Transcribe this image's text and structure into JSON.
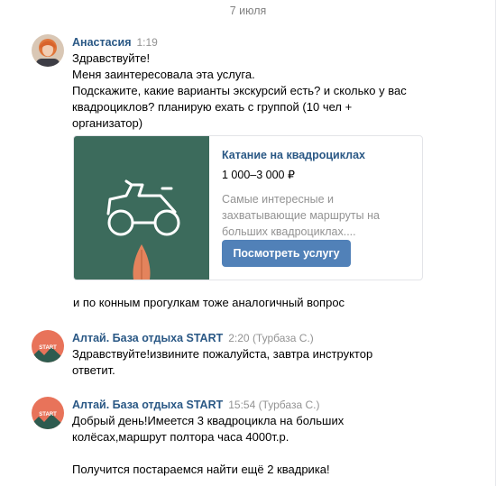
{
  "date_divider": "7 июля",
  "messages": [
    {
      "author": "Анастасия",
      "time": "1:19",
      "lines": [
        "Здравствуйте!",
        "Меня заинтересовала эта услуга.",
        "Подскажите, какие варианты экскурсий есть? и сколько у вас",
        "квадроциклов? планирую ехать с группой (10 чел +",
        "организатор)"
      ]
    },
    {
      "author": "Алтай. База отдыха START",
      "time": "2:20 (Турбаза С.)",
      "lines": [
        "Здравствуйте!извините пожалуйста, завтра инструктор",
        "ответит."
      ]
    },
    {
      "author": "Алтай. База отдыха START",
      "time": "15:54 (Турбаза С.)",
      "lines": [
        "Добрый день!Имеется 3 квадроцикла на больших",
        "колёсах,маршрут полтора часа 4000т.р.",
        "",
        "Получится постараемся найти ещё 2 квадрика!"
      ]
    }
  ],
  "service_card": {
    "title": "Катание на квадроциклах",
    "price": "1 000–3 000 ₽",
    "description": [
      "Самые интересные и",
      "захватывающие маршруты на",
      "больших квадроциклах...."
    ],
    "button_label": "Посмотреть услугу",
    "image_icon": "atv-icon",
    "image_bg": "#3c6b5c"
  },
  "followup_text": "и по конным прогулкам тоже аналогичный вопрос",
  "avatar_start_label": "START",
  "colors": {
    "author": "#2a5885",
    "button": "#5181b8",
    "muted": "#939393",
    "avatar_start": "#e8735a"
  }
}
